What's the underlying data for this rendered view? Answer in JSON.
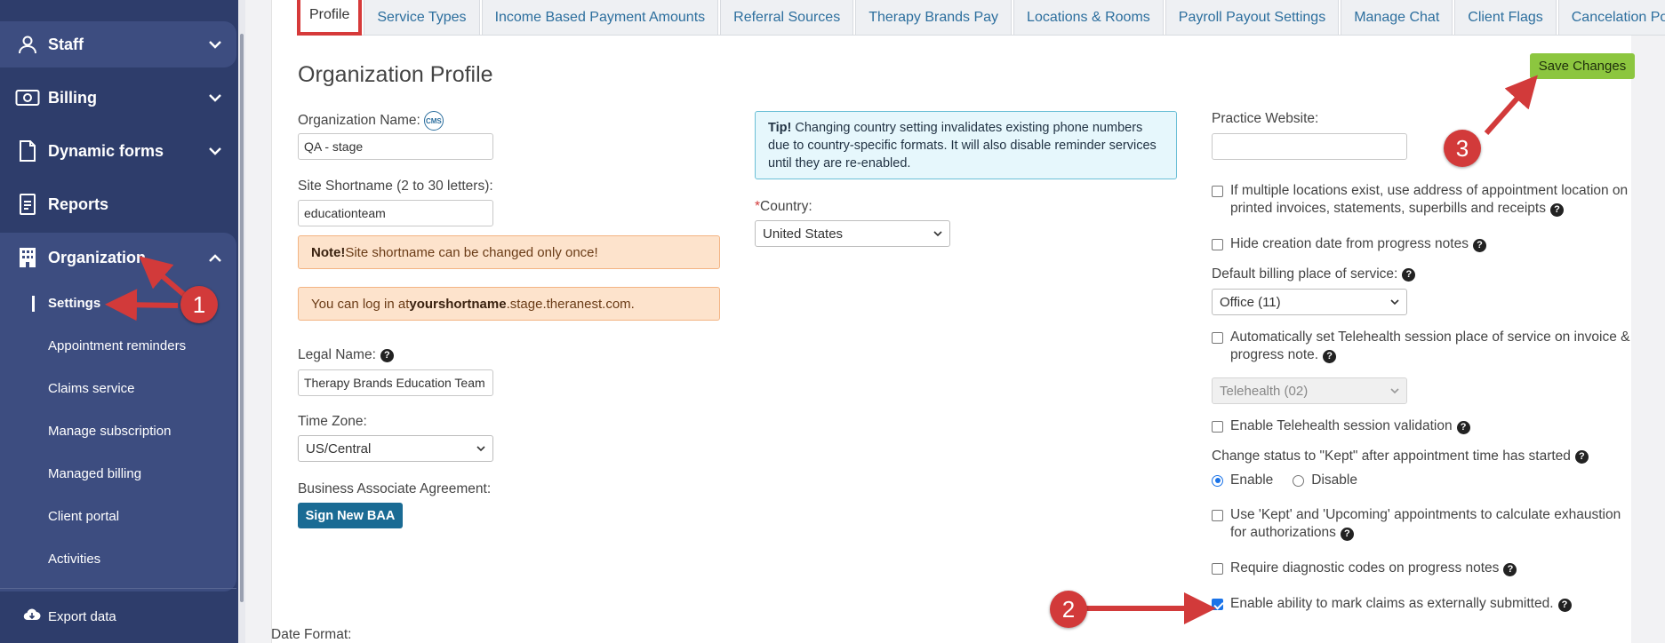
{
  "sidebar": {
    "items": [
      {
        "label": "Staff",
        "icon": "staff-icon"
      },
      {
        "label": "Billing",
        "icon": "billing-icon"
      },
      {
        "label": "Dynamic forms",
        "icon": "document-icon"
      },
      {
        "label": "Reports",
        "icon": "reports-icon"
      },
      {
        "label": "Organization",
        "icon": "building-icon"
      }
    ],
    "org_subitems": [
      "Settings",
      "Appointment reminders",
      "Claims service",
      "Manage subscription",
      "Managed billing",
      "Client portal",
      "Activities"
    ],
    "export_label": "Export data"
  },
  "tabs": [
    "Profile",
    "Service Types",
    "Income Based Payment Amounts",
    "Referral Sources",
    "Therapy Brands Pay",
    "Locations & Rooms",
    "Payroll Payout Settings",
    "Manage Chat",
    "Client Flags",
    "Cancelation Policy"
  ],
  "page": {
    "title": "Organization Profile",
    "save_label": "Save Changes"
  },
  "form": {
    "org_name_label": "Organization Name:",
    "cms_badge": "CMS",
    "org_name_value": "QA - stage",
    "shortname_label": "Site Shortname (2 to 30 letters):",
    "shortname_value": "educationteam",
    "note_bold": "Note!",
    "note_text": " Site shortname can be changed only once!",
    "login_pre": "You can log in at ",
    "login_bold": "yourshortname",
    "login_post": ".stage.theranest.com.",
    "legal_name_label": "Legal Name:",
    "legal_name_value": "Therapy Brands Education Team",
    "timezone_label": "Time Zone:",
    "timezone_value": "US/Central",
    "baa_label": "Business Associate Agreement:",
    "baa_button": "Sign New BAA",
    "date_format_label": "Date Format:",
    "tip_bold": "Tip!",
    "tip_text": " Changing country setting invalidates existing phone numbers due to country-specific formats. It will also disable reminder services until they are re-enabled.",
    "country_required": "*",
    "country_label": " Country:",
    "country_value": "United States",
    "website_label": "Practice Website:",
    "website_value": "",
    "cb_multiple_locations": "If multiple locations exist, use address of appointment location on printed invoices, statements, superbills and receipts",
    "cb_hide_creation_date": "Hide creation date from progress notes",
    "pos_label": "Default billing place of service:",
    "pos_value": "Office (11)",
    "cb_telehealth_pos": "Automatically set Telehealth session place of service on invoice & progress note.",
    "telehealth_value": "Telehealth (02)",
    "cb_telehealth_validation": "Enable Telehealth session validation",
    "kept_label": "Change status to \"Kept\" after appointment time has started",
    "radio_enable": "Enable",
    "radio_disable": "Disable",
    "cb_kept_upcoming": "Use 'Kept' and 'Upcoming' appointments to calculate exhaustion for authorizations",
    "cb_require_diag": "Require diagnostic codes on progress notes",
    "cb_mark_claims": "Enable ability to mark claims as externally submitted."
  },
  "annotations": [
    "1",
    "2",
    "3"
  ],
  "colors": {
    "sidebar": "#2e3d6b",
    "sidebar_active": "#3d4d80",
    "save_button": "#8cc63f",
    "baa_button": "#1a6b94",
    "annotation": "#d23a3a",
    "link": "#2d6f9e"
  }
}
